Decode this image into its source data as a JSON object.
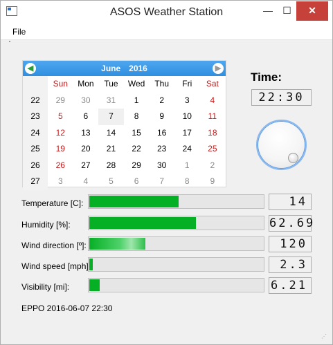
{
  "window": {
    "title": "ASOS Weather Station",
    "min_glyph": "—",
    "max_glyph": "☐",
    "close_glyph": "✕",
    "app_icon": "window-app-icon"
  },
  "menu": {
    "file_label": "File"
  },
  "calendar": {
    "month": "June",
    "year": "2016",
    "prev_icon": "arrow-left-icon",
    "next_icon": "arrow-right-icon",
    "weekdays": [
      "Sun",
      "Mon",
      "Tue",
      "Wed",
      "Thu",
      "Fri",
      "Sat"
    ],
    "weeks": [
      {
        "num": "22",
        "days": [
          [
            "29",
            "dim"
          ],
          [
            "30",
            "dim"
          ],
          [
            "31",
            "dim"
          ],
          [
            "1",
            ""
          ],
          [
            "2",
            ""
          ],
          [
            "3",
            ""
          ],
          [
            "4",
            ""
          ]
        ]
      },
      {
        "num": "23",
        "days": [
          [
            "5",
            ""
          ],
          [
            "6",
            ""
          ],
          [
            "7",
            "selected"
          ],
          [
            "8",
            ""
          ],
          [
            "9",
            ""
          ],
          [
            "10",
            ""
          ],
          [
            "11",
            ""
          ]
        ]
      },
      {
        "num": "24",
        "days": [
          [
            "12",
            ""
          ],
          [
            "13",
            ""
          ],
          [
            "14",
            ""
          ],
          [
            "15",
            ""
          ],
          [
            "16",
            ""
          ],
          [
            "17",
            ""
          ],
          [
            "18",
            ""
          ]
        ]
      },
      {
        "num": "25",
        "days": [
          [
            "19",
            ""
          ],
          [
            "20",
            ""
          ],
          [
            "21",
            ""
          ],
          [
            "22",
            ""
          ],
          [
            "23",
            ""
          ],
          [
            "24",
            ""
          ],
          [
            "25",
            ""
          ]
        ]
      },
      {
        "num": "26",
        "days": [
          [
            "26",
            ""
          ],
          [
            "27",
            ""
          ],
          [
            "28",
            ""
          ],
          [
            "29",
            ""
          ],
          [
            "30",
            ""
          ],
          [
            "1",
            "dim"
          ],
          [
            "2",
            "dim"
          ]
        ]
      },
      {
        "num": "27",
        "days": [
          [
            "3",
            "dim"
          ],
          [
            "4",
            "dim"
          ],
          [
            "5",
            "dim"
          ],
          [
            "6",
            "dim"
          ],
          [
            "7",
            "dim"
          ],
          [
            "8",
            "dim"
          ],
          [
            "9",
            "dim"
          ]
        ]
      }
    ]
  },
  "time": {
    "label": "Time:",
    "value": "22:30"
  },
  "dial_icon": "dial-knob",
  "measurements": [
    {
      "label": "Temperature [C]:",
      "value": "14",
      "fill_fraction": 0.51,
      "style": "solid"
    },
    {
      "label": "Humidity [%]:",
      "value": "62.69",
      "fill_fraction": 0.61,
      "style": "solid"
    },
    {
      "label": "Wind direction [º]:",
      "value": "120",
      "fill_fraction": 0.32,
      "style": "glow"
    },
    {
      "label": "Wind speed [mph]:",
      "value": "2.3",
      "fill_fraction": 0.02,
      "style": "solid"
    },
    {
      "label": "Visibility [mi]:",
      "value": "6.21",
      "fill_fraction": 0.06,
      "style": "solid"
    }
  ],
  "status": {
    "text": "EPPO 2016-06-07 22:30"
  },
  "colors": {
    "bar_fill": "#06b025",
    "calendar_header": "#2f8fe0",
    "weekend": "#c41a1a",
    "close_button": "#c7413b"
  }
}
